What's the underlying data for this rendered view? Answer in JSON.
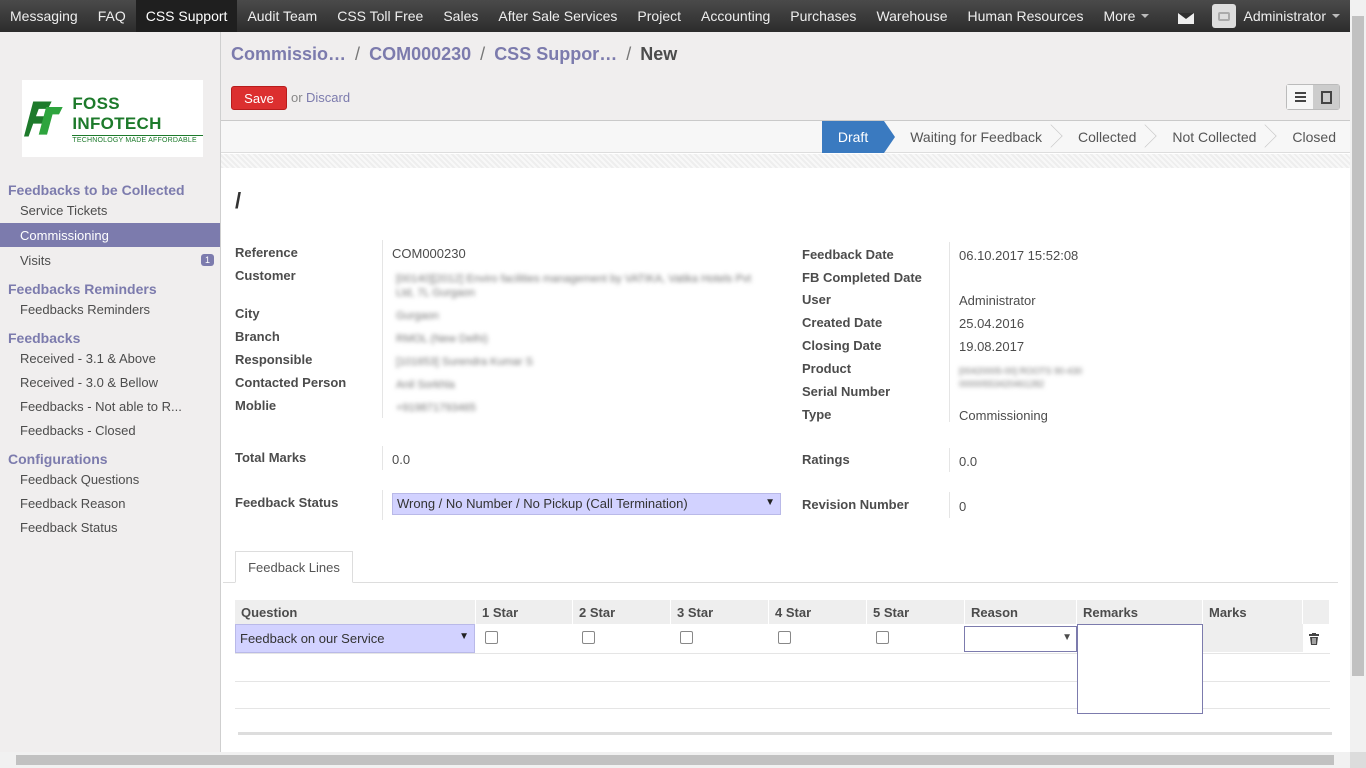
{
  "topbar": {
    "menu": [
      "Messaging",
      "FAQ",
      "CSS Support",
      "Audit Team",
      "CSS Toll Free",
      "Sales",
      "After Sale Services",
      "Project",
      "Accounting",
      "Purchases",
      "Warehouse",
      "Human Resources",
      "More"
    ],
    "active_index": 2,
    "user": "Administrator"
  },
  "logo": {
    "line1": "FOSS INFOTECH",
    "line2": "TECHNOLOGY MADE AFFORDABLE"
  },
  "sidebar": {
    "sections": [
      {
        "title": "Feedbacks to be Collected",
        "items": [
          {
            "label": "Service Tickets"
          },
          {
            "label": "Commissioning",
            "active": true
          },
          {
            "label": "Visits",
            "badge": "1"
          }
        ]
      },
      {
        "title": "Feedbacks Reminders",
        "items": [
          {
            "label": "Feedbacks Reminders"
          }
        ]
      },
      {
        "title": "Feedbacks",
        "items": [
          {
            "label": "Received - 3.1 & Above"
          },
          {
            "label": "Received - 3.0 & Bellow"
          },
          {
            "label": "Feedbacks - Not able to R..."
          },
          {
            "label": "Feedbacks - Closed"
          }
        ]
      },
      {
        "title": "Configurations",
        "items": [
          {
            "label": "Feedback Questions"
          },
          {
            "label": "Feedback Reason"
          },
          {
            "label": "Feedback Status"
          }
        ]
      }
    ]
  },
  "breadcrumb": {
    "b1": "Commissio…",
    "b2": "COM000230",
    "b3": "CSS Suppor…",
    "current": "New",
    "sep": "/"
  },
  "buttons": {
    "save": "Save",
    "or": "or",
    "discard": "Discard"
  },
  "stages": [
    "Draft",
    "Waiting for Feedback",
    "Collected",
    "Not Collected",
    "Closed"
  ],
  "stage_active": "Draft",
  "form": {
    "name": "/",
    "left": {
      "reference_label": "Reference",
      "reference": "COM000230",
      "customer_label": "Customer",
      "customer": "[00140][2012] Enviro facilities management by VATIKA, Vatika Hotels Pvt Ltd, 7L Gurgaon",
      "city_label": "City",
      "city": "Gurgaon",
      "branch_label": "Branch",
      "branch": "RMOL (New Delhi)",
      "responsible_label": "Responsible",
      "responsible": "[101653] Surendra Kumar S",
      "contacted_label": "Contacted Person",
      "contacted": "Anil Sorkhla",
      "mobile_label": "Moblie",
      "mobile": "+919871793465",
      "total_marks_label": "Total Marks",
      "total_marks": "0.0",
      "feedback_status_label": "Feedback Status",
      "feedback_status": "Wrong / No Number / No Pickup (Call Termination)"
    },
    "right": {
      "feedback_date_label": "Feedback Date",
      "feedback_date": "06.10.2017 15:52:08",
      "fb_completed_label": "FB Completed Date",
      "user_label": "User",
      "user": "Administrator",
      "created_label": "Created Date",
      "created": "25.04.2016",
      "closing_label": "Closing Date",
      "closing": "19.08.2017",
      "product_label": "Product",
      "product": "[00420005-00] ROOTS 90-430",
      "serial_label": "Serial Number",
      "serial": "00000553420461282",
      "type_label": "Type",
      "type": "Commissioning",
      "ratings_label": "Ratings",
      "ratings": "0.0",
      "revision_label": "Revision Number",
      "revision": "0"
    }
  },
  "tab": "Feedback Lines",
  "grid": {
    "headers": [
      "Question",
      "1 Star",
      "2 Star",
      "3 Star",
      "4 Star",
      "5 Star",
      "Reason",
      "Remarks",
      "Marks"
    ],
    "row": {
      "question": "Feedback on our Service"
    }
  },
  "colors": {
    "accent": "#7c7bad",
    "save": "#dc2f2f",
    "stage_active": "#3a7ac0"
  }
}
